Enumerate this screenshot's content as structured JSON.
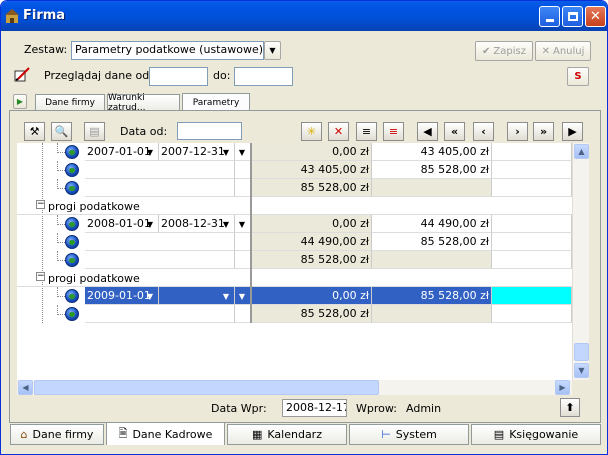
{
  "window": {
    "title": "Firma"
  },
  "header": {
    "zestaw_label": "Zestaw:",
    "zestaw_value": "Parametry podatkowe (ustawowe)",
    "save_label": "Zapisz",
    "cancel_label": "Anuluj",
    "browse_label": "Przeglądaj dane od:",
    "browse_from": "",
    "to_label": "do:",
    "browse_to": ""
  },
  "tabs": [
    {
      "label": "Dane firmy"
    },
    {
      "label": "Warunki zatrud..."
    },
    {
      "label": "Parametry"
    }
  ],
  "toolbar": {
    "date_from_label": "Data od:",
    "date_from_value": ""
  },
  "grid": {
    "rows": [
      {
        "type": "dates",
        "from": "2007-01-01",
        "to": "2007-12-31",
        "v1": "0,00 zł",
        "v2": "43 405,00 zł"
      },
      {
        "type": "vals",
        "v1": "43 405,00 zł",
        "v2": "85 528,00 zł"
      },
      {
        "type": "vals",
        "v1": "85 528,00 zł",
        "v2": ""
      },
      {
        "type": "group",
        "label": "progi podatkowe"
      },
      {
        "type": "dates",
        "from": "2008-01-01",
        "to": "2008-12-31",
        "v1": "0,00 zł",
        "v2": "44 490,00 zł"
      },
      {
        "type": "vals",
        "v1": "44 490,00 zł",
        "v2": "85 528,00 zł"
      },
      {
        "type": "vals",
        "v1": "85 528,00 zł",
        "v2": ""
      },
      {
        "type": "group",
        "label": "progi podatkowe"
      },
      {
        "type": "dates",
        "from": "2009-01-01",
        "to": "",
        "v1": "0,00 zł",
        "v2": "85 528,00 zł",
        "selected": true
      },
      {
        "type": "vals",
        "v1": "85 528,00 zł",
        "v2": ""
      }
    ]
  },
  "footer": {
    "data_wpr_label": "Data Wpr:",
    "data_wpr_value": "2008-12-17",
    "wprow_label": "Wprow:",
    "wprow_value": "Admin"
  },
  "bottom_tabs": [
    {
      "label": "Dane firmy",
      "icon": "home-icon"
    },
    {
      "label": "Dane Kadrowe",
      "icon": "document-icon"
    },
    {
      "label": "Kalendarz",
      "icon": "calendar-icon"
    },
    {
      "label": "System",
      "icon": "tree-icon"
    },
    {
      "label": "Księgowanie",
      "icon": "ledger-icon"
    }
  ],
  "colors": {
    "titlebar": "#0054e3",
    "selection": "#3161c3",
    "highlight_cell": "#00ffff"
  }
}
